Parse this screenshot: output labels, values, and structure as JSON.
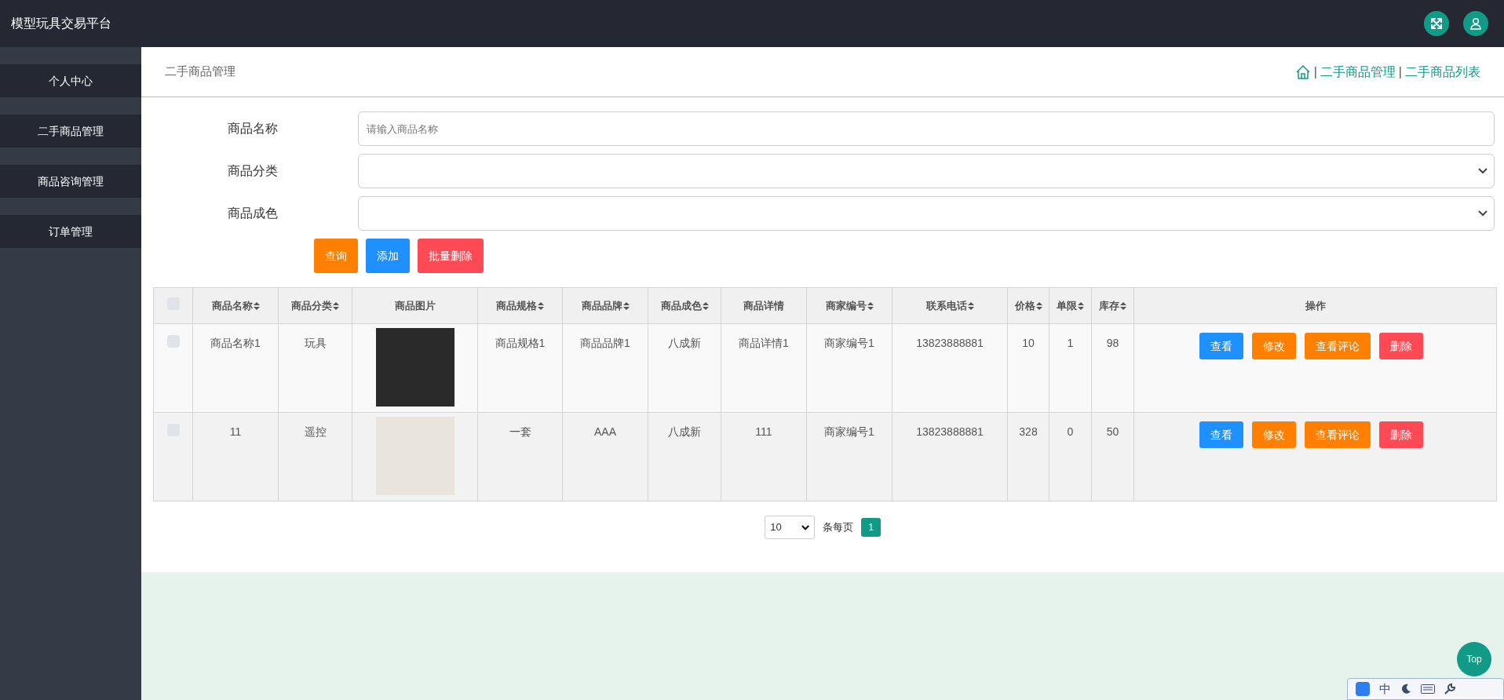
{
  "header": {
    "title": "模型玩具交易平台"
  },
  "sidebar": {
    "items": [
      {
        "label": "个人中心",
        "selected": false
      },
      {
        "label": "二手商品管理",
        "selected": false
      },
      {
        "label": "商品咨询管理",
        "selected": false
      },
      {
        "label": "订单管理",
        "selected": false
      }
    ]
  },
  "page": {
    "title": "二手商品管理",
    "breadcrumb": [
      {
        "separator": "|",
        "label": "二手商品管理"
      },
      {
        "separator": "|",
        "label": "二手商品列表"
      }
    ]
  },
  "search_form": {
    "fields": [
      {
        "label": "商品名称",
        "kind": "input",
        "placeholder": "请输入商品名称"
      },
      {
        "label": "商品分类",
        "kind": "select"
      },
      {
        "label": "商品成色",
        "kind": "select"
      }
    ],
    "buttons": [
      {
        "label": "查询",
        "kind": "orange"
      },
      {
        "label": "添加",
        "kind": "blue"
      },
      {
        "label": "批量删除",
        "kind": "red"
      }
    ]
  },
  "table": {
    "select_all_checked": false,
    "columns": [
      {
        "label": "商品名称",
        "sortable": true
      },
      {
        "label": "商品分类",
        "sortable": true
      },
      {
        "label": "商品图片",
        "sortable": false
      },
      {
        "label": "商品规格",
        "sortable": true
      },
      {
        "label": "商品品牌",
        "sortable": true
      },
      {
        "label": "商品成色",
        "sortable": true
      },
      {
        "label": "商品详情",
        "sortable": false
      },
      {
        "label": "商家编号",
        "sortable": true
      },
      {
        "label": "联系电话",
        "sortable": true
      },
      {
        "label": "价格",
        "sortable": true
      },
      {
        "label": "单限",
        "sortable": true
      },
      {
        "label": "库存",
        "sortable": true
      },
      {
        "label": "操作",
        "sortable": false
      }
    ],
    "rows": [
      {
        "checked": false,
        "name": "商品名称1",
        "category": "玩具",
        "spec": "商品规格1",
        "brand": "商品品牌1",
        "condition": "八成新",
        "detail": "商品详情1",
        "merchant": "商家编号1",
        "phone": "13823888881",
        "price": "10",
        "limit": "1",
        "stock": "98",
        "actions": [
          {
            "label": "查看",
            "kind": "blue"
          },
          {
            "label": "修改",
            "kind": "orange"
          },
          {
            "label": "查看评论",
            "kind": "orange"
          },
          {
            "label": "删除",
            "kind": "red"
          }
        ]
      },
      {
        "checked": false,
        "name": "11",
        "category": "遥控",
        "spec": "一套",
        "brand": "AAA",
        "condition": "八成新",
        "detail": "111",
        "merchant": "商家编号1",
        "phone": "13823888881",
        "price": "328",
        "limit": "0",
        "stock": "50",
        "actions": [
          {
            "label": "查看",
            "kind": "blue"
          },
          {
            "label": "修改",
            "kind": "orange"
          },
          {
            "label": "查看评论",
            "kind": "orange"
          },
          {
            "label": "删除",
            "kind": "red"
          }
        ]
      }
    ]
  },
  "pagination": {
    "page_size": "10",
    "per_page_label": "条每页",
    "pages": [
      {
        "label": "1",
        "selected": true
      }
    ]
  },
  "top_button": "Top",
  "ime_bar": {
    "mode": "中"
  }
}
